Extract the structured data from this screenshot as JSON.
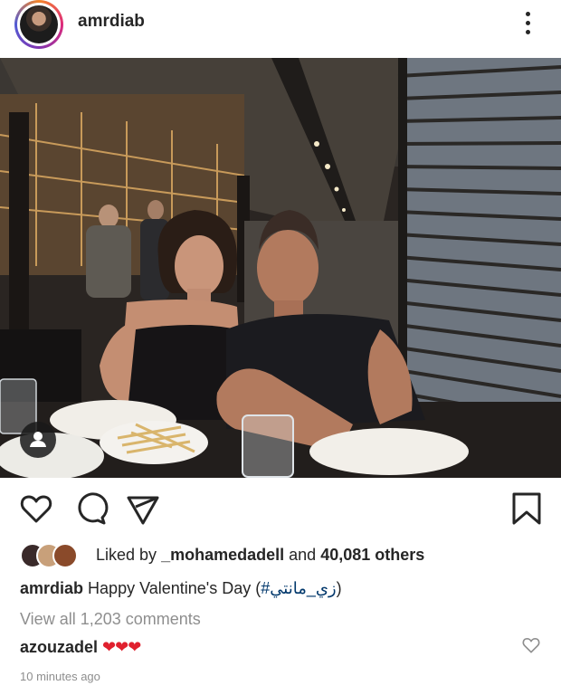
{
  "header": {
    "username": "amrdiab"
  },
  "post": {
    "image_alt": "Photo of a couple seated at a restaurant table"
  },
  "likes": {
    "prefix": "Liked by",
    "user": "_mohamedadell",
    "middle": "and",
    "count": "40,081 others"
  },
  "caption": {
    "user": "amrdiab",
    "text": "Happy Valentine's Day (",
    "hashtag": "#زي_مانتي",
    "close": ")"
  },
  "comments": {
    "view_all": "View all 1,203 comments",
    "items": [
      {
        "user": "azouzadel",
        "text": "❤❤❤"
      }
    ]
  },
  "timestamp": "10 minutes ago",
  "colors": {
    "text": "#262626",
    "muted": "#8e8e8e",
    "heart": "#e0202e",
    "hashtag": "#00376b"
  },
  "icons": [
    "more-vertical-icon",
    "heart-icon",
    "comment-icon",
    "share-icon",
    "bookmark-icon",
    "person-tag-icon"
  ]
}
